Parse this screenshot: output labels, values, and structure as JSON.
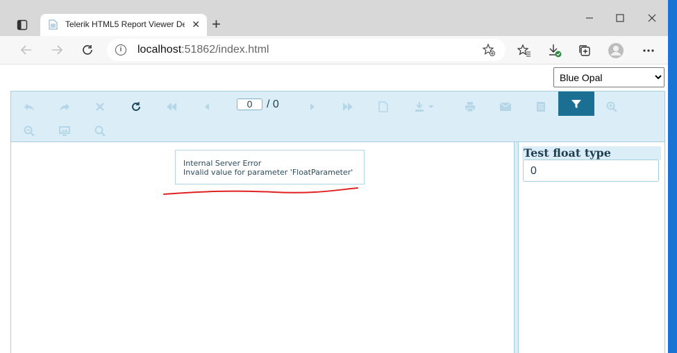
{
  "browser": {
    "tab_title": "Telerik HTML5 Report Viewer De",
    "new_tab_symbol": "+",
    "url_host": "localhost",
    "url_rest": ":51862/index.html"
  },
  "page": {
    "theme_options": [
      "Blue Opal"
    ],
    "theme_selected": "Blue Opal"
  },
  "viewer": {
    "toolbar": {
      "current_page": "0",
      "page_separator": "/ 0",
      "icons": [
        "back-icon",
        "forward-icon",
        "stop-icon",
        "refresh-icon",
        "first-page-icon",
        "previous-page-icon",
        "next-page-icon",
        "last-page-icon",
        "document-map-icon",
        "export-icon",
        "print-icon",
        "send-mail-icon",
        "print-preview-icon",
        "filter-icon",
        "zoom-in-icon",
        "zoom-out-icon",
        "toggle-view-icon",
        "search-icon"
      ]
    },
    "error": {
      "line1": "Internal Server Error",
      "line2": "Invalid value for parameter 'FloatParameter'"
    },
    "parameters": {
      "title": "Test float type",
      "value": "0"
    }
  },
  "colors": {
    "accent": "#1b6f93",
    "toolbar_bg": "#dbeef8",
    "annotation": "#e02020",
    "desktop": "#1a73d6"
  }
}
